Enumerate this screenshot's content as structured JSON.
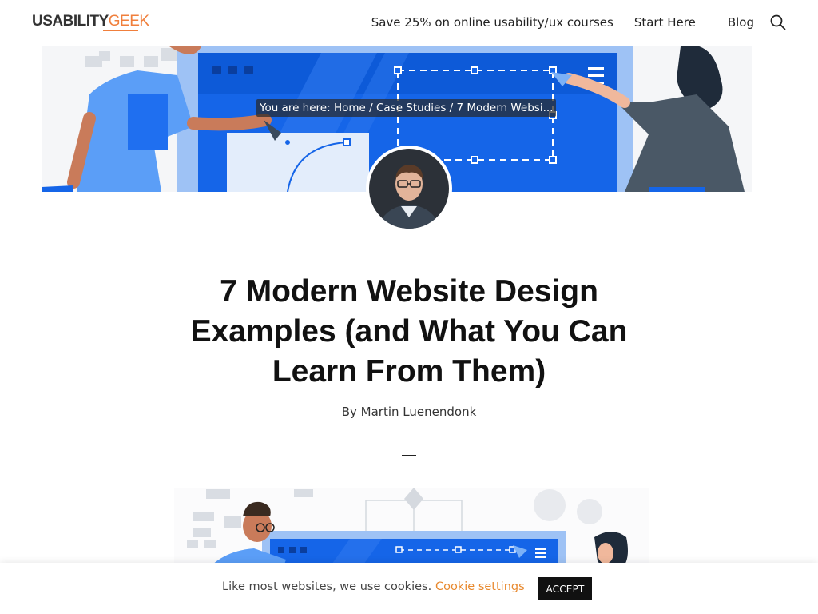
{
  "header": {
    "logo_part1": "USABILITY",
    "logo_part2": "GEEK",
    "nav": {
      "promo": "Save 25% on online usability/ux courses",
      "start": "Start Here",
      "blog": "Blog"
    },
    "search_icon": "search-icon"
  },
  "breadcrumb": {
    "prefix": "You are here: ",
    "home": "Home",
    "sep": " / ",
    "section": "Case Studies",
    "current": "7 Modern Websi..."
  },
  "article": {
    "title": "7 Modern Website Design Examples (and What You Can Learn From Them)",
    "byline": "By Martin Luenendonk"
  },
  "cookie": {
    "message": "Like most websites, we use cookies.",
    "settings": "Cookie settings",
    "accept": "ACCEPT"
  },
  "colors": {
    "brand_orange": "#f07f3c",
    "hero_blue": "#1565e8",
    "light_blue": "#7cb1f7"
  }
}
